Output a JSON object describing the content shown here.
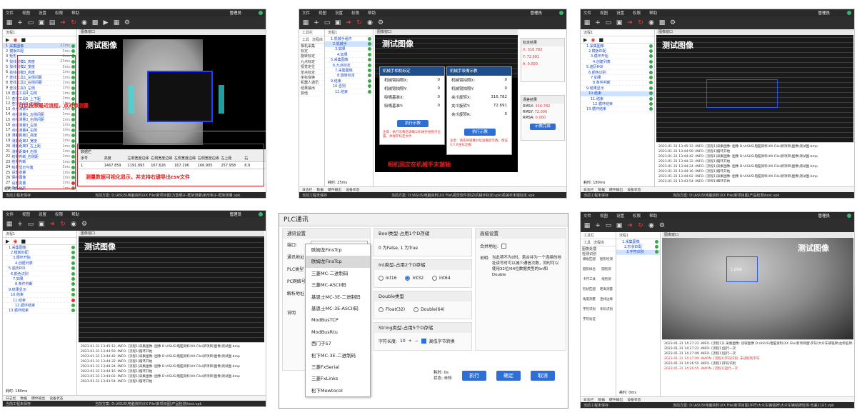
{
  "menu": [
    "文件",
    "视图",
    "设置",
    "权限",
    "帮助"
  ],
  "app_title": "管理员",
  "flow_label": "流程1",
  "image_window": "图像窗口",
  "image_title": "测试图像",
  "log_tabs": [
    "日志栏",
    "数据",
    "硬件输出",
    "设备状态"
  ],
  "status_left": "当前工程未保存",
  "panel1": {
    "status_path": "当前方案: D:\\ASUS\\电脑资料\\XX File\\新项目图\\方案细子-框架测量\\条形电子-框架测量.vpk",
    "runtime": "耗时: 89ms",
    "steps": [
      {
        "n": "1",
        "label": "采集图像",
        "ms": "21ms",
        "state": "ok"
      },
      {
        "n": "2",
        "label": "模板匹配",
        "ms": "3ms",
        "state": "ok"
      },
      {
        "n": "3",
        "label": "矩形",
        "ms": "0ms",
        "state": "ok"
      },
      {
        "n": "4",
        "label": "找线找模1_高度",
        "ms": "23ms",
        "state": "ok"
      },
      {
        "n": "5",
        "label": "找线找模2_宽度",
        "ms": "5ms",
        "state": "ok"
      },
      {
        "n": "6",
        "label": "找线找模3_高度",
        "ms": "1ms",
        "state": "ok"
      },
      {
        "n": "7",
        "label": "查找工具1_左侧间距",
        "ms": "3ms",
        "state": "ok"
      },
      {
        "n": "8",
        "label": "查找工具2_右侧间距",
        "ms": "1ms",
        "state": "ok"
      },
      {
        "n": "9",
        "label": "查找工具3_左侧",
        "ms": "1ms",
        "state": "ok"
      },
      {
        "n": "10",
        "label": "查找工具4_右侧",
        "ms": "1ms",
        "state": "ok"
      },
      {
        "n": "11",
        "label": "查找工具5_上下距",
        "ms": "2ms",
        "state": "ok"
      },
      {
        "n": "12",
        "label": "查找工具6_右侧距",
        "ms": "1ms",
        "state": "ok"
      },
      {
        "n": "13",
        "label": "点点测量1",
        "ms": "1ms",
        "state": "ok"
      },
      {
        "n": "14",
        "label": "点线测量1_左侧间距",
        "ms": "1ms",
        "state": "ok"
      },
      {
        "n": "15",
        "label": "点线测量2_右侧间距",
        "ms": "1ms",
        "state": "ok"
      },
      {
        "n": "16",
        "label": "点线测量3_左侧",
        "ms": "1ms",
        "state": "ok"
      },
      {
        "n": "17",
        "label": "点线测量4_右侧",
        "ms": "1ms",
        "state": "ok"
      },
      {
        "n": "18",
        "label": "测量距离1_高度",
        "ms": "1ms",
        "state": "ok"
      },
      {
        "n": "19",
        "label": "测量距离2_宽度",
        "ms": "1ms",
        "state": "ok"
      },
      {
        "n": "20",
        "label": "测量距离3_左上距",
        "ms": "1ms",
        "state": "ok"
      },
      {
        "n": "21",
        "label": "测量距离4_右侧",
        "ms": "1ms",
        "state": "ok"
      },
      {
        "n": "22",
        "label": "结果判断_右侧距",
        "ms": "1ms",
        "state": "ok"
      },
      {
        "n": "23",
        "label": "结果判断",
        "ms": "1ms",
        "state": "ok"
      },
      {
        "n": "24",
        "label": "结果显示与储",
        "ms": "5ms",
        "state": "ok"
      },
      {
        "n": "25",
        "label": "设置变量",
        "ms": "1ms",
        "state": "ok"
      },
      {
        "n": "26",
        "label": "保存图像",
        "ms": "1ms",
        "state": "ok"
      },
      {
        "n": "27",
        "label": "设置变量",
        "ms": "1ms",
        "state": "ng"
      },
      {
        "n": "28",
        "label": "条件分支",
        "ms": "1ms",
        "state": "ok"
      }
    ],
    "annot_left": "可以按照最近流程，点对点测量",
    "annot_bottom": "测量数据可视化显示，并支持右键导出csv文件",
    "table_header": [
      "序号",
      "高度",
      "左侧宽度边缘",
      "右侧宽度边缘",
      "左侧宽度边缘",
      "右侧宽度边缘",
      "左上距",
      "右"
    ],
    "table_row": [
      "1",
      "1467.859",
      "2191.893",
      "167.626",
      "167.196",
      "166.905",
      "257.958",
      "6.9"
    ],
    "data_title": "数据栏"
  },
  "panel2": {
    "toolbox_title": "工具栏",
    "toolbox_tabs": [
      "工具",
      "流程库"
    ],
    "flow_steps": [
      {
        "label": "1.机械手组件",
        "state": "ok"
      },
      {
        "label": "2.机械手",
        "state": "ok"
      },
      {
        "label": "3.如果",
        "state": "ok"
      },
      {
        "label": "4.如果",
        "state": "ok"
      },
      {
        "label": "5.采集图像",
        "state": "ok"
      },
      {
        "label": "6.九点标定",
        "state": "ok"
      },
      {
        "label": "7.采集图像",
        "state": "ok"
      },
      {
        "label": "8.旋转标定",
        "state": "ok"
      },
      {
        "label": "9.结束",
        "state": "ok"
      },
      {
        "label": "10.否则",
        "state": "ok"
      },
      {
        "label": "11.结束",
        "state": "ok"
      }
    ],
    "tool_groups": [
      "相机采集",
      "标定",
      "旋转标定",
      "九点标定",
      "视觉定位",
      "单点标定",
      "坐标变换",
      "机器人通讯",
      "结果输出",
      "其他"
    ],
    "dlg_left_title": "机械手相机标定",
    "dlg_left_fields": [
      {
        "label": "机械臂拍照X:",
        "value": "0"
      },
      {
        "label": "机械臂拍照Y:",
        "value": "0"
      },
      {
        "label": "吸嘴基准X:",
        "value": "0"
      },
      {
        "label": "吸嘴基准Y:",
        "value": "0"
      }
    ],
    "dlg_left_btn": "执行示教",
    "dlg_left_note": "注意：执行示教后请确认机械手拍照点位置，并保存标定文件",
    "dlg_right_title": "机械手吸嘴示教",
    "dlg_right_fields": [
      {
        "label": "机械臂拍照X:",
        "value": "0"
      },
      {
        "label": "机械臂拍照Y:",
        "value": "0"
      },
      {
        "label": "夹爪旋转X:",
        "value": "316.782"
      },
      {
        "label": "夹爪旋转Y:",
        "value": "72.691"
      },
      {
        "label": "夹爪旋转R:",
        "value": "0"
      }
    ],
    "dlg_right_btn": "执行示教",
    "dlg_right_note": "注意：请先将吸嘴对位准确后示教，保证X,Y,R坐标正确",
    "result_title": "标定结果",
    "result_values": {
      "X": "316.782",
      "Y": "72.691",
      "A": "0.000"
    },
    "error_title": "误差结果",
    "error_values": {
      "RMSX": "316.782",
      "RMSY": "72.000",
      "RMSA": "0.000"
    },
    "error_btn": "示教完成",
    "annot": "相机固定在机械手末端轴",
    "runtime": "耗时: 25ms",
    "status_path": "当前方案: D:\\ASUS\\电脑资料\\XX File\\视觉软件测试\\机械手标定\\vpk\\机械手末端标定.vpk"
  },
  "panel3": {
    "steps": [
      {
        "label": "1.采集图像",
        "state": "ok"
      },
      {
        "label": "2.模板匹配",
        "state": "ok"
      },
      {
        "label": "3.循环开始",
        "state": "ok"
      },
      {
        "label": "4.创建列表",
        "state": "ok"
      },
      {
        "label": "5.遍历ROI",
        "state": "ok"
      },
      {
        "label": "6.颜色识别",
        "state": "ok"
      },
      {
        "label": "7.如果",
        "state": "ok"
      },
      {
        "label": "8.条件判断",
        "state": "ok"
      },
      {
        "label": "9.结果显示",
        "state": "ok"
      },
      {
        "label": "10.结束",
        "state": "ok"
      },
      {
        "label": "11.结束",
        "state": "ok"
      },
      {
        "label": "12.循环结束",
        "state": "ok"
      },
      {
        "label": "13.循环结束",
        "state": "ok"
      }
    ],
    "log_lines": [
      "2023-01-31 13:45:12 -INFO- [流程1]采集图像: 图像 D:\\ASUS\\电脑资料\\XX File\\新项目\\图像\\测试图.bmp",
      "2023-01-31 13:44:59 -INFO- [流程1]循环开始",
      "2023-01-31 13:44:42 -INFO- [流程1]采集图像: 图像 D:\\ASUS\\电脑资料\\XX File\\新项目\\图像\\测试图.bmp",
      "2023-01-31 13:44:32 -INFO- [流程1]循环开始",
      "2023-01-31 13:44:24 -INFO- [流程1]采集图像: 图像 D:\\ASUS\\电脑资料\\XX File\\新项目\\图像\\测试图.bmp",
      "2023-01-31 13:44:16 -INFO- [流程1]循环开始",
      "2023-01-31 13:44:02 -INFO- [流程1]采集图像: 图像 D:\\ASUS\\电脑资料\\XX File\\新项目\\图像\\测试图.bmp",
      "2023-01-31 13:43:54 -INFO- [流程1]循环开始",
      "2023-01-31 13:43:47 -INFO- [流程1]采集图像: 图像 D:\\ASUS\\电脑资料\\XX File\\新项目\\图像\\测试图.bmp"
    ],
    "runtime": "耗时: 180ms",
    "status_path": "当前方案: D:\\ASUS\\电脑资料\\XX File\\新项目图\\产品检测\\test.vpk"
  },
  "panel4": {
    "steps": [
      {
        "label": "1.采集图像",
        "state": "ok"
      },
      {
        "label": "2.模板匹配",
        "state": "ok"
      },
      {
        "label": "3.循环开始",
        "state": "ok"
      },
      {
        "label": "4.创建列表",
        "state": "ok"
      },
      {
        "label": "5.遍历ROI",
        "state": "ok"
      },
      {
        "label": "6.颜色识别",
        "state": "ok"
      },
      {
        "label": "7.如果",
        "state": "ok"
      },
      {
        "label": "8.条件判断",
        "state": "ok"
      },
      {
        "label": "9.结果显示",
        "state": "ok"
      },
      {
        "label": "10.结束",
        "state": "ok"
      },
      {
        "label": "11.结束",
        "state": "ng"
      },
      {
        "label": "12.循环结束",
        "state": "ok"
      },
      {
        "label": "13.循环结束",
        "state": "ok"
      }
    ],
    "log_lines": [
      "2023-01-31 13:45:12 -INFO- [流程1]采集图像: 图像 D:\\ASUS\\电脑资料\\XX File\\新项目\\图像\\测试图.bmp",
      "2023-01-31 13:44:59 -INFO- [流程1]循环开始",
      "2023-01-31 13:44:42 -INFO- [流程1]采集图像: 图像 D:\\ASUS\\电脑资料\\XX File\\新项目\\图像\\测试图.bmp",
      "2023-01-31 13:44:32 -INFO- [流程1]循环开始",
      "2023-01-31 13:44:24 -INFO- [流程1]采集图像: 图像 D:\\ASUS\\电脑资料\\XX File\\新项目\\图像\\测试图.bmp",
      "2023-01-31 13:44:16 -INFO- [流程1]循环开始",
      "2023-01-31 13:44:02 -INFO- [流程1]采集图像: 图像 D:\\ASUS\\电脑资料\\XX File\\新项目\\图像\\测试图.bmp",
      "2023-01-31 13:43:54 -INFO- [流程1]循环开始"
    ],
    "runtime": "耗时: 180ms",
    "status_path": "当前方案: D:\\ASUS\\电脑资料\\XX File\\新项目图\\产品检测\\test.vpk"
  },
  "panel5": {
    "title": "PLC通讯",
    "section_comm": "通讯设置",
    "port_label": "端口:",
    "addr_label": "通讯地址",
    "plc_type_label": "PLC类型",
    "plc_ip_label": "PC网络号",
    "parse_label": "解析地址",
    "desc_label": "说明",
    "plc_options": [
      "欧姆龙FinsTcp",
      "欧姆龙FinsTcp",
      "三菱MC-二进制码",
      "三菱MC-ASCII码",
      "基恩士MC-3E-二进制码",
      "基恩士MC-3E-ASCII码",
      "ModBusTCP",
      "ModBusRtu",
      "西门子S7",
      "松下MC-3E-二进制码",
      "三菱FxSerial",
      "三菱FxLinks",
      "松下Mewtocol"
    ],
    "bool_title": "Bool类型-占用1个D存储",
    "bool_text": "0 为False, 1 为True",
    "int_title": "Int类型-占用2个D存储",
    "int_options": [
      "Int16",
      "Int32",
      "Int64"
    ],
    "double_title": "Double类型",
    "double_options": [
      "Float(32)",
      "Double(64)"
    ],
    "string_title": "String类型-占用5个D存储",
    "string_len_label": "字符长度:",
    "string_len": "10",
    "swap_label": "高低字节转换",
    "advanced_title": "高级设置",
    "merge_label": "合并地址:",
    "note_label": "说明:",
    "note_text": "当此项不为0时，若合并为一个连续的地址读写时可以减少通信次数，同时可以使用32位/64位数据类型的Int和Double",
    "time_label": "耗时: 0s",
    "status_label": "状态: 未知",
    "run_btn": "执行",
    "ok_btn": "确定",
    "cancel_btn": "取消"
  },
  "panel6": {
    "toolbox_title": "工具栏",
    "tabs": [
      "工具",
      "流程库"
    ],
    "tool_groups": [
      "图像处理",
      "检测识别"
    ],
    "tools": [
      "模板匹配",
      "图形检测",
      "圆形拟合",
      "圆检测",
      "卡尺工具",
      "线检测",
      "形状匹配",
      "距离测量",
      "角度测量",
      "查找边缘",
      "字符识别",
      "条码识别",
      "字符验证"
    ],
    "steps": [
      {
        "label": "1.采集图像",
        "state": "ok"
      },
      {
        "label": "2.形状匹配",
        "state": "ok"
      },
      {
        "label": "3.字符识别",
        "state": "ok"
      }
    ],
    "ocr_text": "1.OCR",
    "log_lines": [
      {
        "t": "2023-01-31 14:27:22 -INFO- [流程1]1.采集图像: 读取图像 D:\\ASUS\\电脑资料\\XX File\\新项目图\\字符\\大众车辆铭牌\\左侧名牌.bmp",
        "red": false
      },
      {
        "t": "2023-01-31 14:27:22 -INFO- [流程1]运行一次",
        "red": false
      },
      {
        "t": "2023-01-31 14:27:09 -INFO- [流程1]运行一次",
        "red": false
      },
      {
        "t": "2023-01-31 14:27:09 -WARN- [流程1]字符识别: 未读取到字符",
        "red": true
      },
      {
        "t": "2023-01-31 14:26:55 -INFO- [流程1]字符识别",
        "red": false
      },
      {
        "t": "2023-01-31 14:26:55 -WARN- [流程1]运行一次",
        "red": true
      }
    ],
    "runtime": "耗时: 0ms",
    "status_path": "当前方案: D:\\ASUS\\电脑资料\\XX File\\新项目图\\字符\\大众车辆铭牌\\大众车辆铭牌检测-无差1103.vpk"
  }
}
